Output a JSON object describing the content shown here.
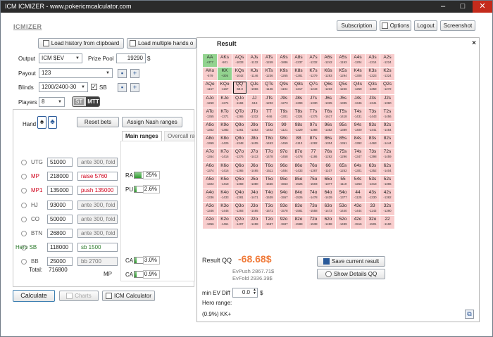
{
  "titlebar": {
    "title": "ICM ICMIZER - www.pokericmcalculator.com"
  },
  "app": {
    "logo": "ICMIZER"
  },
  "header_buttons": {
    "subscription": "Subscription",
    "options": "Options",
    "logout": "Logout",
    "screenshot": "Screenshot"
  },
  "load": {
    "history": "Load history from clipboard",
    "multiple": "Load multiple hands o"
  },
  "settings": {
    "output_label": "Output",
    "output_value": "ICM $EV",
    "prize_pool_label": "Prize Pool",
    "prize_pool_value": "19290",
    "prize_pool_unit": "$",
    "payout_label": "Payout",
    "payout_value": "123",
    "blinds_label": "Blinds",
    "blinds_value": "1200/2400-30",
    "sb_label": "SB",
    "players_label": "Players",
    "players_value": "8",
    "mode_st": "ST",
    "mode_mtt": "MTT"
  },
  "hand": {
    "label": "Hand",
    "reset_bets": "Reset bets",
    "assign_nash": "Assign Nash ranges"
  },
  "range_tabs": {
    "main": "Main ranges",
    "overcall": "Overcall ra"
  },
  "players": [
    {
      "pos": "UTG",
      "stack": "51000",
      "action": "ante 300, fold",
      "style": "gray",
      "pos_style": ""
    },
    {
      "pos": "MP",
      "stack": "218000",
      "action": "raise 5760",
      "style": "red",
      "pos_style": "red"
    },
    {
      "pos": "MP1",
      "stack": "135000",
      "action": "push 135000",
      "style": "red",
      "pos_style": "red"
    },
    {
      "pos": "HJ",
      "stack": "93000",
      "action": "ante 300, fold",
      "style": "gray",
      "pos_style": ""
    },
    {
      "pos": "CO",
      "stack": "50000",
      "action": "ante 300, fold",
      "style": "gray",
      "pos_style": ""
    },
    {
      "pos": "BTN",
      "stack": "26800",
      "action": "ante 300, fold",
      "style": "gray",
      "pos_style": ""
    },
    {
      "pos": "Hero SB",
      "stack": "118000",
      "action": "sb 1500",
      "style": "green",
      "pos_style": "green"
    },
    {
      "pos": "BB",
      "stack": "25000",
      "action": "bb 2700",
      "style": "gray",
      "pos_style": ""
    }
  ],
  "total": {
    "label": "Total:",
    "value": "716800"
  },
  "ranges": [
    {
      "label": "RA",
      "value": "25%",
      "fraction": 0.25,
      "row": 0
    },
    {
      "label": "PU",
      "value": "2.6%",
      "fraction": 0.026,
      "row": 1
    },
    {
      "label": "CA",
      "value": "3.0%",
      "fraction": 0.03,
      "row": 6
    },
    {
      "label": "CA",
      "value": "0.9%",
      "fraction": 0.009,
      "row": 7
    }
  ],
  "mp_label": "MP",
  "bottom_buttons": {
    "calculate": "Calculate",
    "charts": "Charts",
    "icm_calculator": "ICM Calculator"
  },
  "result": {
    "title": "Result",
    "close": "×",
    "label": "Result QQ",
    "value": "-68.68$",
    "ev_push": "EvPush 2867.71$",
    "ev_fold": "EvFold 2936.39$",
    "save": "Save current result",
    "show_details": "Show Details QQ",
    "min_ev_label": "min EV Diff",
    "min_ev_value": "0.0",
    "min_ev_unit": "$",
    "hero_range_label": "Hero range:",
    "hero_range_value": "(0.9%) KK+"
  },
  "grid": [
    [
      [
        "AA",
        "+377",
        "push"
      ],
      [
        "AKs",
        "-501",
        ""
      ],
      [
        "AQs",
        "-1033",
        ""
      ],
      [
        "AJs",
        "-1132",
        ""
      ],
      [
        "ATs",
        "-1249",
        ""
      ],
      [
        "A9s",
        "-1886",
        ""
      ],
      [
        "A8s",
        "-1237",
        ""
      ],
      [
        "A7s",
        "-1232",
        ""
      ],
      [
        "A6s",
        "-1242",
        ""
      ],
      [
        "A5s",
        "-1193",
        ""
      ],
      [
        "A4s",
        "-1204",
        ""
      ],
      [
        "A3s",
        "-1214",
        ""
      ],
      [
        "A2s",
        "-1224",
        ""
      ]
    ],
    [
      [
        "AKo",
        "-579",
        ""
      ],
      [
        "KK",
        "+305",
        "push"
      ],
      [
        "KQs",
        "-1042",
        ""
      ],
      [
        "KJs",
        "-1146",
        ""
      ],
      [
        "KTs",
        "-1236",
        ""
      ],
      [
        "K9s",
        "-1265",
        ""
      ],
      [
        "K8s",
        "-1281",
        ""
      ],
      [
        "K7s",
        "-1279",
        ""
      ],
      [
        "K6s",
        "-1283",
        ""
      ],
      [
        "K5s",
        "-1294",
        ""
      ],
      [
        "K4s",
        "-1308",
        ""
      ],
      [
        "K3s",
        "-1323",
        ""
      ],
      [
        "K2s",
        "-1324",
        ""
      ]
    ],
    [
      [
        "AQo",
        "-1157",
        ""
      ],
      [
        "KQo",
        "-1167",
        ""
      ],
      [
        "QQ",
        "-69.0",
        "sel"
      ],
      [
        "QJs",
        "-1066",
        ""
      ],
      [
        "QTs",
        "-1136",
        ""
      ],
      [
        "Q9s",
        "-1194",
        ""
      ],
      [
        "Q8s",
        "-1217",
        ""
      ],
      [
        "Q7s",
        "-1243",
        ""
      ],
      [
        "Q6s",
        "-1233",
        ""
      ],
      [
        "Q5s",
        "-1246",
        ""
      ],
      [
        "Q4s",
        "-1259",
        ""
      ],
      [
        "Q3s",
        "-1259",
        ""
      ],
      [
        "Q2s",
        "-1272",
        ""
      ]
    ],
    [
      [
        "AJo",
        "-1260",
        ""
      ],
      [
        "KJo",
        "-1274",
        ""
      ],
      [
        "QJo",
        "-1169",
        ""
      ],
      [
        "JJ",
        "-519",
        ""
      ],
      [
        "JTs",
        "-1202",
        ""
      ],
      [
        "J9s",
        "-1273",
        ""
      ],
      [
        "J8s",
        "-1299",
        ""
      ],
      [
        "J7s",
        "-1330",
        ""
      ],
      [
        "J6s",
        "-1325",
        ""
      ],
      [
        "J5s",
        "-1335",
        ""
      ],
      [
        "J4s",
        "-1346",
        ""
      ],
      [
        "J3s",
        "-1341",
        ""
      ],
      [
        "J2s",
        "-1360",
        ""
      ]
    ],
    [
      [
        "ATo",
        "-1355",
        ""
      ],
      [
        "KTo",
        "-1371",
        ""
      ],
      [
        "QTo",
        "-1265",
        ""
      ],
      [
        "JTo",
        "-1332",
        ""
      ],
      [
        "TT",
        "-946",
        ""
      ],
      [
        "T9s",
        "-1301",
        ""
      ],
      [
        "T8s",
        "-1324",
        ""
      ],
      [
        "T7s",
        "-1375",
        ""
      ],
      [
        "T6s",
        "-1617",
        ""
      ],
      [
        "T5s",
        "-1418",
        ""
      ],
      [
        "T4s",
        "-1431",
        ""
      ],
      [
        "T3s",
        "-1443",
        ""
      ],
      [
        "T2s",
        "-1456",
        ""
      ]
    ],
    [
      [
        "A9o",
        "-1352",
        ""
      ],
      [
        "K9o",
        "-1382",
        ""
      ],
      [
        "Q9o",
        "-1361",
        ""
      ],
      [
        "J9o",
        "-1363",
        ""
      ],
      [
        "T9o",
        "-1402",
        ""
      ],
      [
        "99",
        "-1121",
        ""
      ],
      [
        "98s",
        "-1329",
        ""
      ],
      [
        "97s",
        "-1388",
        ""
      ],
      [
        "96s",
        "-1352",
        ""
      ],
      [
        "95s",
        "-1389",
        ""
      ],
      [
        "94s",
        "-1400",
        ""
      ],
      [
        "93s",
        "-1441",
        ""
      ],
      [
        "92s",
        "-1454",
        ""
      ]
    ],
    [
      [
        "A8o",
        "-1369",
        ""
      ],
      [
        "K8o",
        "-1425",
        ""
      ],
      [
        "Q8o",
        "-1348",
        ""
      ],
      [
        "J8o",
        "-1405",
        ""
      ],
      [
        "T8o",
        "-1453",
        ""
      ],
      [
        "98o",
        "-1459",
        ""
      ],
      [
        "88",
        "-1113",
        ""
      ],
      [
        "87s",
        "-1282",
        ""
      ],
      [
        "86s",
        "-1304",
        ""
      ],
      [
        "85s",
        "-1361",
        ""
      ],
      [
        "84s",
        "-1392",
        ""
      ],
      [
        "83s",
        "-1463",
        ""
      ],
      [
        "82s",
        "-1444",
        ""
      ]
    ],
    [
      [
        "A7o",
        "-1364",
        ""
      ],
      [
        "K7o",
        "-1416",
        ""
      ],
      [
        "Q7o",
        "-1376",
        ""
      ],
      [
        "J7o",
        "-1413",
        ""
      ],
      [
        "T7o",
        "-1478",
        ""
      ],
      [
        "97o",
        "-1458",
        ""
      ],
      [
        "87o",
        "-1478",
        ""
      ],
      [
        "77",
        "-1186",
        ""
      ],
      [
        "76s",
        "-1262",
        ""
      ],
      [
        "75s",
        "-1296",
        ""
      ],
      [
        "74s",
        "-1347",
        ""
      ],
      [
        "73s",
        "-1398",
        ""
      ],
      [
        "72s",
        "-1459",
        ""
      ]
    ],
    [
      [
        "A6o",
        "-1374",
        ""
      ],
      [
        "K6o",
        "-1416",
        ""
      ],
      [
        "Q6o",
        "-1365",
        ""
      ],
      [
        "J6o",
        "-1465",
        ""
      ],
      [
        "T6o",
        "-1511",
        ""
      ],
      [
        "96o",
        "-1484",
        ""
      ],
      [
        "86o",
        "-1433",
        ""
      ],
      [
        "76o",
        "-1387",
        ""
      ],
      [
        "66",
        "-1107",
        ""
      ],
      [
        "65s",
        "-1252",
        ""
      ],
      [
        "64s",
        "-1301",
        ""
      ],
      [
        "63s",
        "-1352",
        ""
      ],
      [
        "62s",
        "-1404",
        ""
      ]
    ],
    [
      [
        "A5o",
        "-1322",
        ""
      ],
      [
        "K5o",
        "-1418",
        ""
      ],
      [
        "Q5o",
        "-1369",
        ""
      ],
      [
        "J5o",
        "-1380",
        ""
      ],
      [
        "T5o",
        "-1556",
        ""
      ],
      [
        "95o",
        "-1553",
        ""
      ],
      [
        "85o",
        "-1526",
        ""
      ],
      [
        "75o",
        "-1503",
        ""
      ],
      [
        "65o",
        "-1377",
        ""
      ],
      [
        "55",
        "-1110",
        ""
      ],
      [
        "54s",
        "-1263",
        ""
      ],
      [
        "53s",
        "-1313",
        ""
      ],
      [
        "52s",
        "-1365",
        ""
      ]
    ],
    [
      [
        "A4o",
        "-1336",
        ""
      ],
      [
        "K4o",
        "-1433",
        ""
      ],
      [
        "Q4o",
        "-1381",
        ""
      ],
      [
        "J4o",
        "-1471",
        ""
      ],
      [
        "T4o",
        "-1539",
        ""
      ],
      [
        "94o",
        "-1557",
        ""
      ],
      [
        "84o",
        "-1526",
        ""
      ],
      [
        "74o",
        "-1478",
        ""
      ],
      [
        "64o",
        "-1429",
        ""
      ],
      [
        "54o",
        "-1377",
        ""
      ],
      [
        "44",
        "-1125",
        ""
      ],
      [
        "43s",
        "-1330",
        ""
      ],
      [
        "42s",
        "-1382",
        ""
      ]
    ],
    [
      [
        "A3o",
        "-1346",
        ""
      ],
      [
        "K3o",
        "-1446",
        ""
      ],
      [
        "Q3o",
        "-1393",
        ""
      ],
      [
        "J3o",
        "-1485",
        ""
      ],
      [
        "T3o",
        "-1571",
        ""
      ],
      [
        "93o",
        "-1578",
        ""
      ],
      [
        "83o",
        "-1581",
        ""
      ],
      [
        "73o",
        "-1558",
        ""
      ],
      [
        "63o",
        "-1473",
        ""
      ],
      [
        "53o",
        "-1440",
        ""
      ],
      [
        "43o",
        "-1444",
        ""
      ],
      [
        "33",
        "-1143",
        ""
      ],
      [
        "32s",
        "-1390",
        ""
      ]
    ],
    [
      [
        "A2o",
        "-1356",
        ""
      ],
      [
        "K2o",
        "-1461",
        ""
      ],
      [
        "Q2o",
        "-1407",
        ""
      ],
      [
        "J2o",
        "-1498",
        ""
      ],
      [
        "T2o",
        "-1587",
        ""
      ],
      [
        "92o",
        "-1597",
        ""
      ],
      [
        "82o",
        "-1588",
        ""
      ],
      [
        "72o",
        "-1538",
        ""
      ],
      [
        "62o",
        "-1498",
        ""
      ],
      [
        "52o",
        "-1499",
        ""
      ],
      [
        "42o",
        "-1516",
        ""
      ],
      [
        "32o",
        "-1501",
        ""
      ],
      [
        "22",
        "-1160",
        ""
      ]
    ]
  ]
}
